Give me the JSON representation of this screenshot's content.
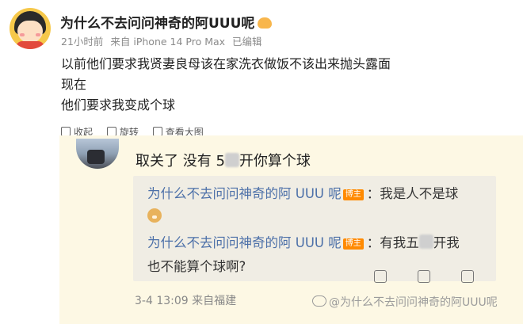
{
  "post": {
    "username": "为什么不去问问神奇的阿UUU呢",
    "meta": {
      "time": "21小时前",
      "source": "来自 iPhone 14 Pro Max",
      "edited": "已编辑"
    },
    "lines": [
      "以前他们要求我贤妻良母该在家洗衣做饭不该出来抛头露面",
      "现在",
      "他们要求我变成个球"
    ],
    "actions": [
      "收起",
      "旋转",
      "查看大图"
    ]
  },
  "comment": {
    "text_before": "取关了 没有 5",
    "text_after": "开你算个球",
    "replies": [
      {
        "name": "为什么不去问问神奇的阿 UUU 呢",
        "badge": "博主",
        "text": "：我是人不是球"
      },
      {
        "name": "为什么不去问问神奇的阿 UUU 呢",
        "badge": "博主",
        "text_before": "：有我五",
        "text_after": "开我",
        "line2": "也不能算个球啊?"
      }
    ],
    "footer": {
      "date": "3-4 13:09",
      "location": "来自福建"
    }
  },
  "watermark": "@为什么不去问问神奇的阿UUU呢",
  "colors": {
    "comment_bg": "#fdf8e4",
    "reply_bg": "#f0ede4",
    "link": "#4b6fa8",
    "badge": "#ff8a00"
  }
}
